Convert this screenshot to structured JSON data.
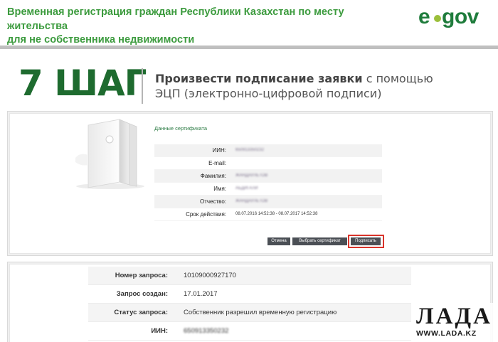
{
  "header": {
    "title_line1": "Временная регистрация граждан Республики Казахстан по месту жительства",
    "title_line2": "для не собственника недвижимости",
    "logo": {
      "e": "e",
      "gov": "gov"
    }
  },
  "step": {
    "number": "7 ШАГ",
    "text_bold": "Произвести подписание заявки",
    "text_rest": " с помощью",
    "text_line2": "ЭЦП (электронно-цифровой подписи)"
  },
  "certificate": {
    "title": "Данные сертификата",
    "rows": [
      {
        "label": "ИИН:",
        "value": "650913350232"
      },
      {
        "label": "E-mail:",
        "value": ""
      },
      {
        "label": "Фамилия:",
        "value": "ЖАНДАУЛЕТОВ"
      },
      {
        "label": "Имя:",
        "value": "АБДИГАЛИ"
      },
      {
        "label": "Отчество:",
        "value": "ЖАНДАУЛЕТОВ"
      },
      {
        "label": "Срок действия:",
        "value": "08.07.2016 14:52:38 - 08.07.2017 14:52:38"
      }
    ]
  },
  "buttons": {
    "cancel": "Отмена",
    "select_cert": "Выбрать сертификат",
    "sign": "Подписать"
  },
  "request": {
    "rows": [
      {
        "label": "Номер запроса:",
        "value": "10109000927170"
      },
      {
        "label": "Запрос создан:",
        "value": "17.01.2017"
      },
      {
        "label": "Статус запроса:",
        "value": "Собственник разрешил временную регистрацию"
      },
      {
        "label": "ИИН:",
        "value": "650913350232"
      }
    ]
  },
  "watermark": {
    "logo": "ЛАДА",
    "url": "WWW.LADA.KZ"
  },
  "colors": {
    "brand_green": "#3c9b3e",
    "step_green": "#1e6b2f",
    "highlight": "#d9342b"
  }
}
